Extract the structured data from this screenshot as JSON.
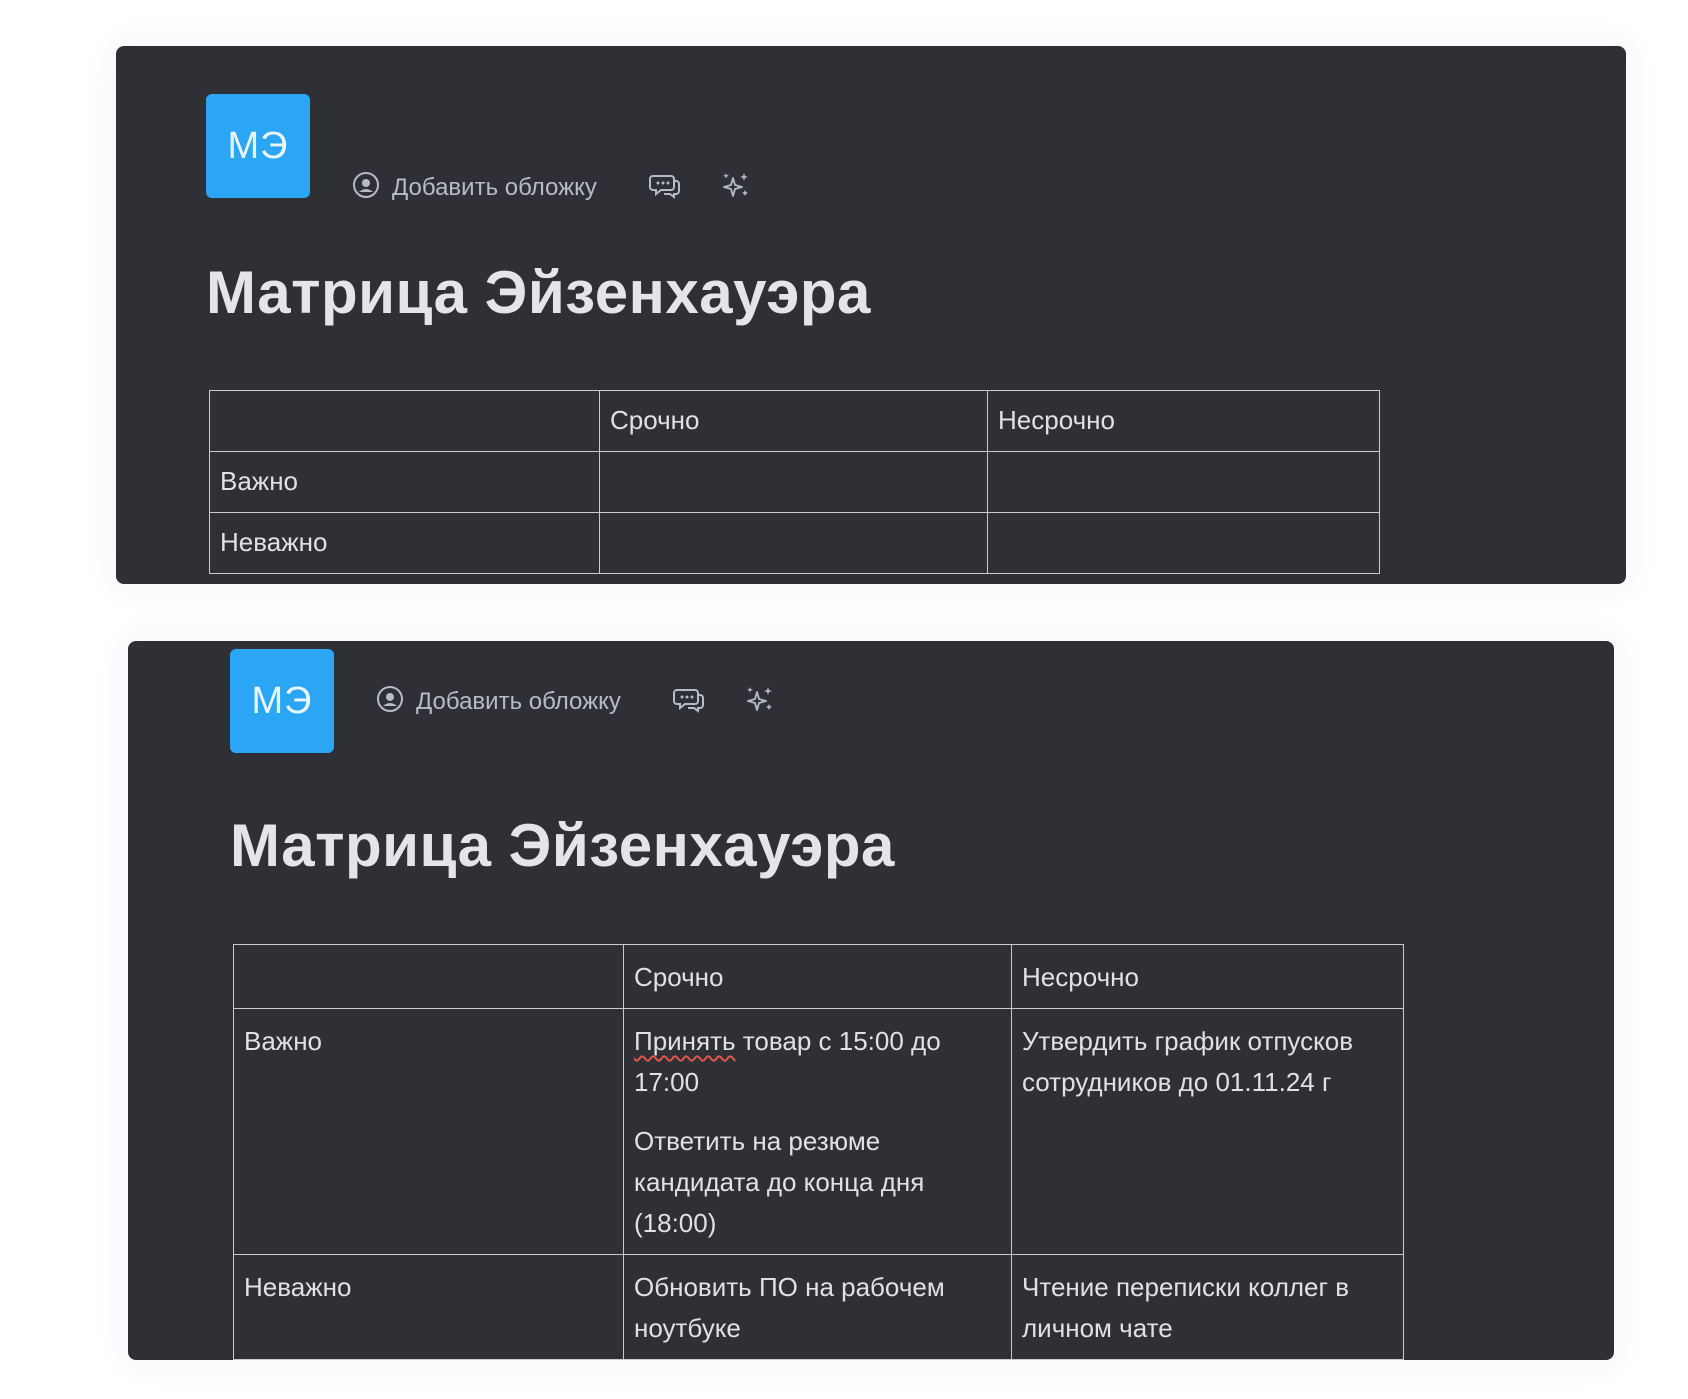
{
  "colors": {
    "page_background": "#ffffff",
    "panel_background": "#2e3035",
    "avatar_background": "#2aa6f5",
    "text_primary": "#e4e5e8",
    "text_secondary": "#b8bbc2",
    "table_border": "#c9cbd0",
    "spellcheck_underline": "#e0564a"
  },
  "panels": [
    {
      "avatar_initials": "МЭ",
      "toolbar": {
        "cover_label": "Добавить обложку",
        "cover_icon": "image-circle-icon",
        "comments_icon": "comments-icon",
        "ai_icon": "sparkles-icon"
      },
      "title": "Матрица Эйзенхауэра",
      "table": {
        "header": [
          "",
          "Срочно",
          "Несрочно"
        ],
        "rows": [
          {
            "label": "Важно",
            "urgent": [],
            "not_urgent": []
          },
          {
            "label": "Неважно",
            "urgent": [],
            "not_urgent": []
          }
        ]
      }
    },
    {
      "avatar_initials": "МЭ",
      "toolbar": {
        "cover_label": "Добавить обложку",
        "cover_icon": "image-circle-icon",
        "comments_icon": "comments-icon",
        "ai_icon": "sparkles-icon"
      },
      "title": "Матрица Эйзенхауэра",
      "table": {
        "header": [
          "",
          "Срочно",
          "Несрочно"
        ],
        "rows": [
          {
            "label": "Важно",
            "urgent_first_word": "Принять",
            "urgent_first_rest": " товар с 15:00 до 17:00",
            "urgent_second": "Ответить на резюме кандидата до конца дня (18:00)",
            "not_urgent": "Утвердить график отпусков сотрудников до 01.11.24 г"
          },
          {
            "label": "Неважно",
            "urgent": "Обновить ПО на рабочем ноутбуке",
            "not_urgent": "Чтение переписки коллег в личном чате"
          }
        ]
      }
    }
  ]
}
